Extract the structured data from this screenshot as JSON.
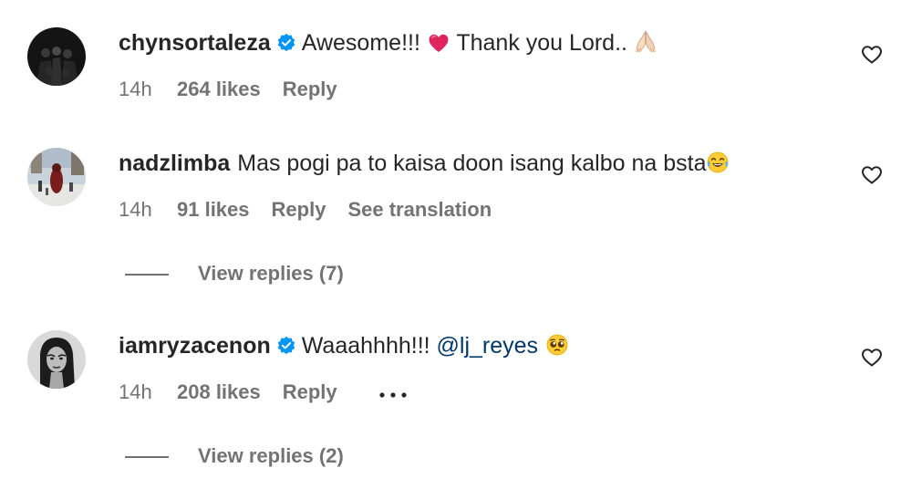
{
  "comments": [
    {
      "username": "chynsortaleza",
      "verified": true,
      "text_before": "Awesome!!! ",
      "emoji1": "red-heart",
      "text_after": " Thank you Lord.. ",
      "emoji2": "folded-hands",
      "time": "14h",
      "likes": "264 likes",
      "reply": "Reply"
    },
    {
      "username": "nadzlimba",
      "verified": false,
      "text": "Mas pogi pa to kaisa doon isang kalbo na bsta",
      "emoji": "tears-of-joy",
      "time": "14h",
      "likes": "91 likes",
      "reply": "Reply",
      "translate": "See translation",
      "view_replies": "View replies (7)"
    },
    {
      "username": "iamryzacenon",
      "verified": true,
      "text": "Waaahhhh!!! ",
      "mention": "@lj_reyes",
      "emoji": "pleading-face",
      "time": "14h",
      "likes": "208 likes",
      "reply": "Reply",
      "view_replies": "View replies (2)"
    }
  ],
  "colors": {
    "text": "#262626",
    "secondary": "#737373",
    "mention": "#00376b",
    "verified": "#0095f6",
    "heart_emoji": "#e0245e"
  }
}
